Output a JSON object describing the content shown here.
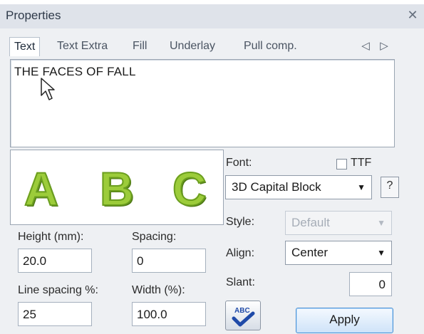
{
  "window": {
    "title": "Properties"
  },
  "tabs": [
    {
      "label": "Text",
      "active": true
    },
    {
      "label": "Text Extra",
      "active": false
    },
    {
      "label": "Fill",
      "active": false
    },
    {
      "label": "Underlay",
      "active": false
    },
    {
      "label": "Pull comp.",
      "active": false
    }
  ],
  "text_content": {
    "value": "THE FACES OF FALL"
  },
  "preview": {
    "letters": [
      "A",
      "B",
      "C"
    ],
    "fill_color": "#9ccc3a",
    "outline_color": "#6b9e1f"
  },
  "font": {
    "label": "Font:",
    "value": "3D Capital Block",
    "ttf_label": "TTF",
    "ttf_checked": false,
    "help_label": "?"
  },
  "style": {
    "label": "Style:",
    "value": "Default",
    "disabled": true
  },
  "align": {
    "label": "Align:",
    "value": "Center"
  },
  "slant": {
    "label": "Slant:",
    "value": "0"
  },
  "height": {
    "label": "Height (mm):",
    "value": "20.0"
  },
  "spacing": {
    "label": "Spacing:",
    "value": "0"
  },
  "line_spacing": {
    "label": "Line spacing %:",
    "value": "25"
  },
  "width": {
    "label": "Width (%):",
    "value": "100.0"
  },
  "buttons": {
    "apply": "Apply",
    "spell_check_icon": "abc-check-icon"
  },
  "nav": {
    "prev": "◁",
    "next": "▷"
  },
  "close_glyph": "✕",
  "colors": {
    "accent": "#4a8fd1",
    "panel_bg": "#eef0f3",
    "title_bg": "#dfe3ea"
  }
}
